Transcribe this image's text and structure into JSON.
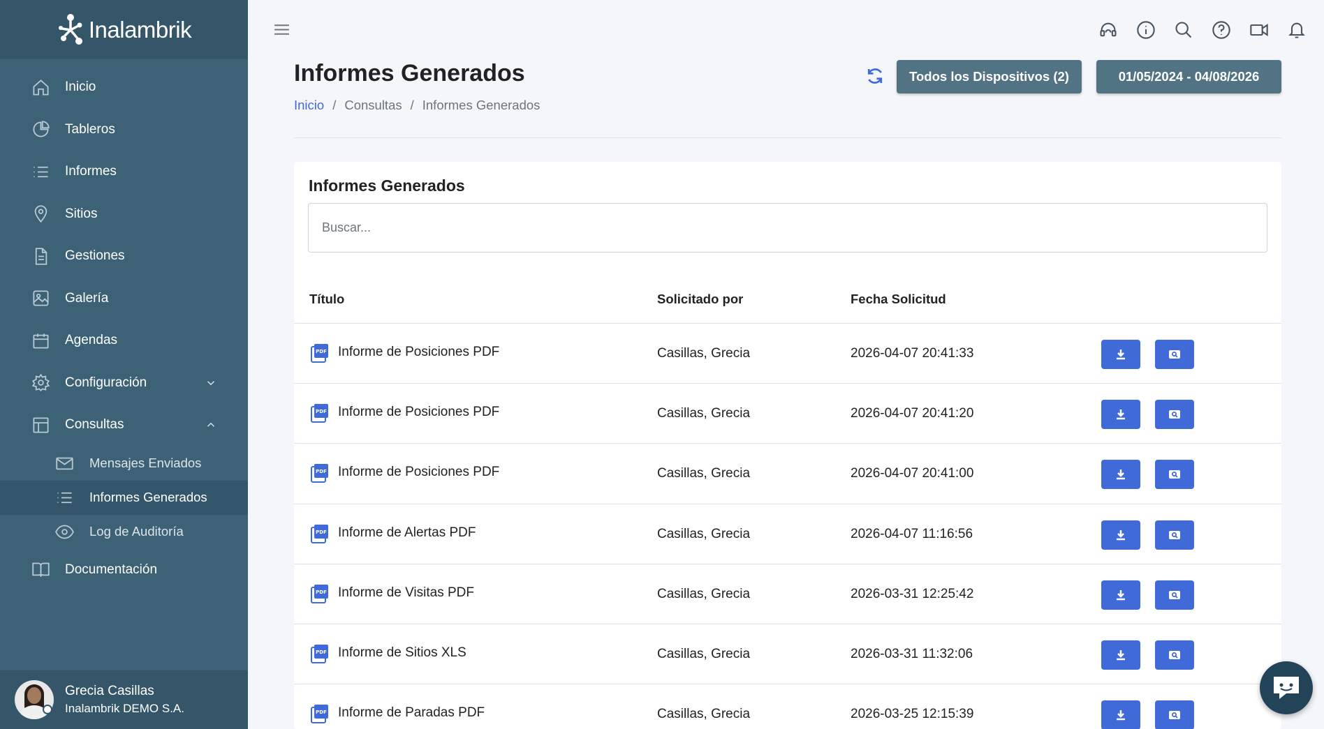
{
  "brand": {
    "name": "Inalambrik"
  },
  "sidebar": {
    "items": [
      {
        "label": "Inicio",
        "icon": "home-icon"
      },
      {
        "label": "Tableros",
        "icon": "pie-chart-icon"
      },
      {
        "label": "Informes",
        "icon": "list-icon"
      },
      {
        "label": "Sitios",
        "icon": "map-pin-icon"
      },
      {
        "label": "Gestiones",
        "icon": "document-icon"
      },
      {
        "label": "Galería",
        "icon": "image-icon"
      },
      {
        "label": "Agendas",
        "icon": "calendar-icon"
      },
      {
        "label": "Configuración",
        "icon": "gear-icon",
        "expandable": true,
        "expanded": false
      },
      {
        "label": "Consultas",
        "icon": "table-icon",
        "expandable": true,
        "expanded": true
      },
      {
        "label": "Documentación",
        "icon": "book-icon"
      }
    ],
    "consultas_sub": [
      {
        "label": "Mensajes Enviados",
        "icon": "mail-icon"
      },
      {
        "label": "Informes Generados",
        "icon": "list-icon",
        "active": true
      },
      {
        "label": "Log de Auditoría",
        "icon": "eye-icon"
      }
    ],
    "user": {
      "name": "Grecia Casillas",
      "org": "Inalambrik DEMO S.A."
    }
  },
  "topbar": {
    "icons": [
      "support-headset-icon",
      "info-icon",
      "search-icon",
      "help-icon",
      "video-icon",
      "bell-icon"
    ]
  },
  "header": {
    "title": "Informes Generados",
    "breadcrumb": [
      "Inicio",
      "Consultas",
      "Informes Generados"
    ],
    "devices_button": "Todos los Dispositivos (2)",
    "date_range_button": "01/05/2024 - 04/08/2026"
  },
  "card": {
    "title": "Informes Generados",
    "search_placeholder": "Buscar...",
    "columns": [
      "Título",
      "Solicitado por",
      "Fecha Solicitud"
    ],
    "rows": [
      {
        "title": "Informe de Posiciones PDF",
        "requested_by": "Casillas, Grecia",
        "date": "2026-04-07 20:41:33"
      },
      {
        "title": "Informe de Posiciones PDF",
        "requested_by": "Casillas, Grecia",
        "date": "2026-04-07 20:41:20"
      },
      {
        "title": "Informe de Posiciones PDF",
        "requested_by": "Casillas, Grecia",
        "date": "2026-04-07 20:41:00"
      },
      {
        "title": "Informe de Alertas PDF",
        "requested_by": "Casillas, Grecia",
        "date": "2026-04-07 11:16:56"
      },
      {
        "title": "Informe de Visitas PDF",
        "requested_by": "Casillas, Grecia",
        "date": "2026-03-31 12:25:42"
      },
      {
        "title": "Informe de Sitios XLS",
        "requested_by": "Casillas, Grecia",
        "date": "2026-03-31 11:32:06"
      },
      {
        "title": "Informe de Paradas PDF",
        "requested_by": "Casillas, Grecia",
        "date": "2026-03-25 12:15:39"
      }
    ]
  },
  "colors": {
    "sidebar_bg": "#3d6275",
    "sidebar_dark": "#345668",
    "accent_blue": "#3f6ad8",
    "header_button": "#517384",
    "chat_bubble": "#234458"
  }
}
